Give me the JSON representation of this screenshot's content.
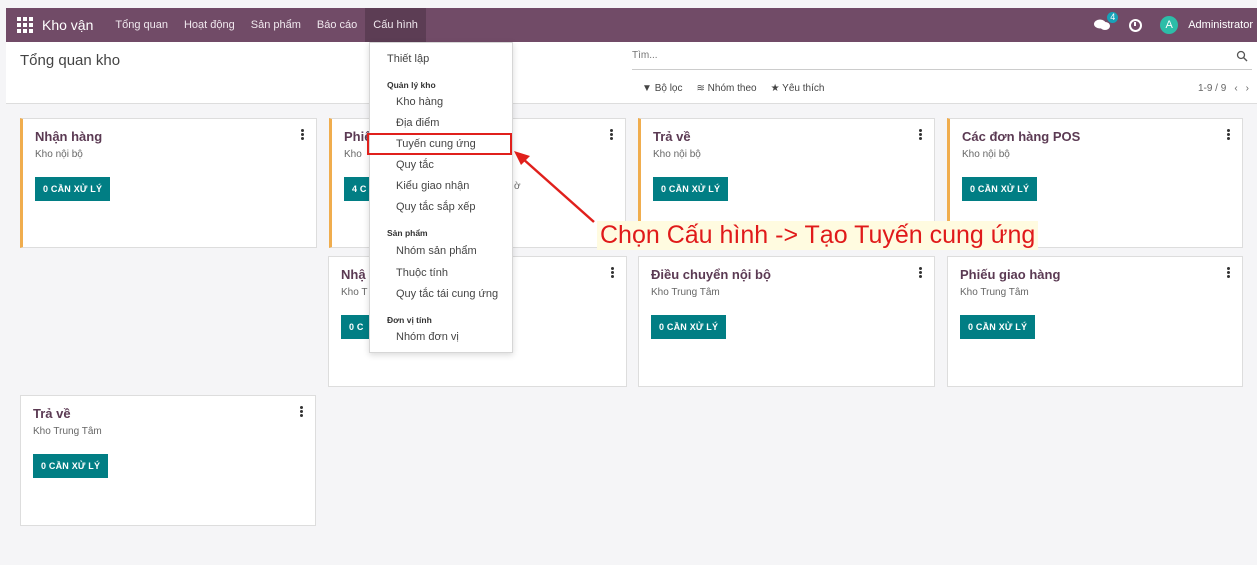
{
  "navbar": {
    "app_name": "Kho vận",
    "items": [
      "Tổng quan",
      "Hoạt động",
      "Sản phẩm",
      "Báo cáo",
      "Cấu hình"
    ],
    "chat_count": "4",
    "user_initial": "A",
    "user_name": "Administrator"
  },
  "control": {
    "title": "Tổng quan kho",
    "search_placeholder": "Tìm...",
    "filter": "Bộ lọc",
    "group_by": "Nhóm theo",
    "favorites": "Yêu thích",
    "pager": "1-9 / 9"
  },
  "cards": [
    {
      "title": "Nhận hàng",
      "sub": "Kho nội bộ",
      "btn": "0 CẦN XỬ LÝ"
    },
    {
      "title": "Phiế",
      "sub": "Kho",
      "btn": "4 C",
      "extra": "ờ"
    },
    {
      "title": "Trả về",
      "sub": "Kho nội bộ",
      "btn": "0 CẦN XỬ LÝ"
    },
    {
      "title": "Các đơn hàng POS",
      "sub": "Kho nội bộ",
      "btn": "0 CẦN XỬ LÝ"
    },
    {
      "title": "Nhậ",
      "sub": "Kho T",
      "btn": "0 C"
    },
    {
      "title": "Điều chuyển nội bộ",
      "sub": "Kho Trung Tâm",
      "btn": "0 CẦN XỬ LÝ"
    },
    {
      "title": "Phiếu giao hàng",
      "sub": "Kho Trung Tâm",
      "btn": "0 CẦN XỬ LÝ"
    },
    {
      "title": "Trả về",
      "sub": "Kho Trung Tâm",
      "btn": "0 CẦN XỬ LÝ"
    }
  ],
  "dropdown": {
    "settings": "Thiết lập",
    "warehouse_header": "Quản lý kho",
    "warehouse_items": [
      "Kho hàng",
      "Địa điểm",
      "Tuyến cung ứng",
      "Quy tắc",
      "Kiểu giao nhận",
      "Quy tắc sắp xếp"
    ],
    "product_header": "Sản phẩm",
    "product_items": [
      "Nhóm sản phẩm",
      "Thuộc tính",
      "Quy tắc tái cung ứng"
    ],
    "uom_header": "Đơn vị tính",
    "uom_items": [
      "Nhóm đơn vị"
    ]
  },
  "annotation": "Chọn Cấu hình -> Tạo Tuyến cung ứng",
  "colors": {
    "brand": "#714b67",
    "button": "#017e84",
    "accent": "#f0ad4e",
    "annotation": "#e01a1a"
  }
}
